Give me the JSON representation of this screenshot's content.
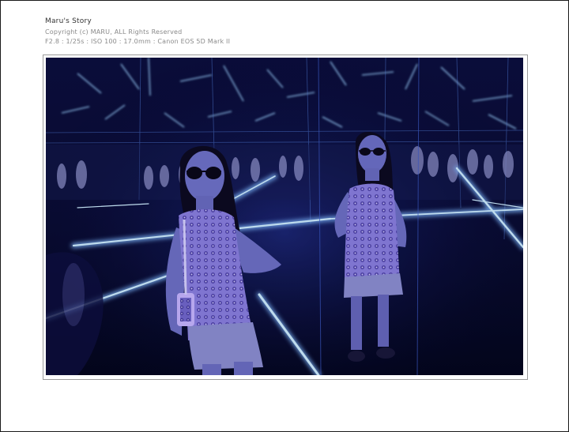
{
  "header": {
    "title": "Maru's Story",
    "copyright": "Copyright (c) MARU, ALL Rights Reserved",
    "exif": "F2.8 : 1/25s : ISO 100 : 17.0mm : Canon EOS 5D Mark II"
  },
  "colors": {
    "background": "#ffffff",
    "frame_border": "#1a1a1a",
    "photo_border": "#9a9a9a",
    "scene_dark": "#06082a",
    "neon_light": "#bfe6ff",
    "outfit": "#7a6fd6"
  }
}
